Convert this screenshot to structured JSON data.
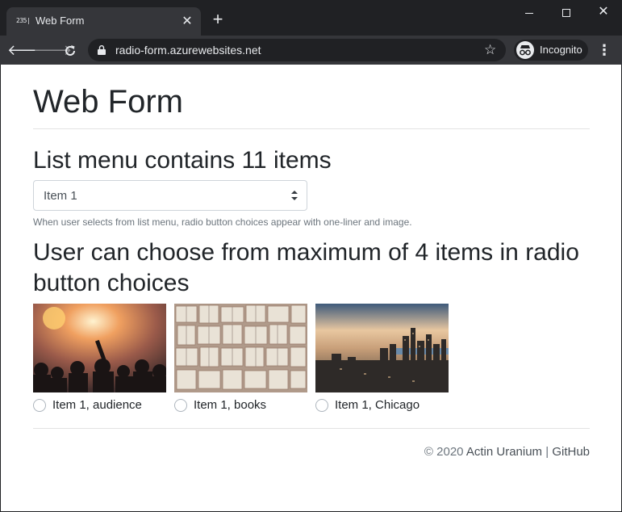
{
  "browser": {
    "tab_title": "Web Form",
    "favicon_text": "235|J",
    "url": "radio-form.azurewebsites.net",
    "incognito_label": "Incognito"
  },
  "page": {
    "title": "Web Form",
    "section_title": "List menu contains 11 items",
    "select": {
      "selected": "Item 1"
    },
    "help_text": "When user selects from list menu, radio button choices appear with one-liner and image.",
    "section_title_2": "User can choose from maximum of 4 items in radio button choices",
    "choices": [
      {
        "label": "Item 1, audience",
        "image": "audience-photo"
      },
      {
        "label": "Item 1, books",
        "image": "books-photo"
      },
      {
        "label": "Item 1, Chicago",
        "image": "chicago-photo"
      }
    ],
    "footer": {
      "copyright": "© 2020",
      "author": "Actin Uranium",
      "separator": "|",
      "link": "GitHub"
    }
  }
}
